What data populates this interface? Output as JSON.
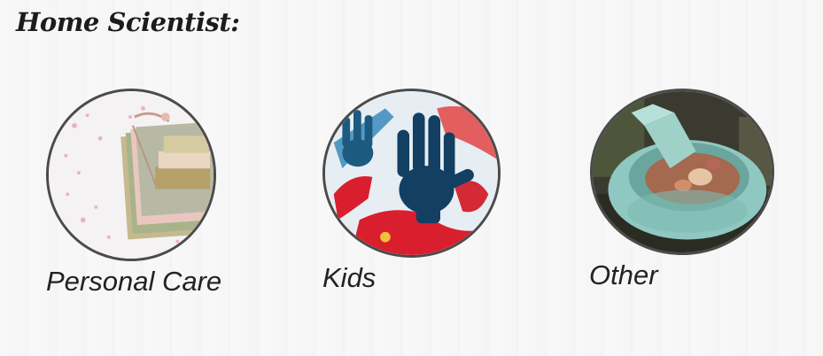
{
  "page": {
    "title": "Home Scientist:"
  },
  "categories": [
    {
      "label": "Personal Care",
      "image": "soap-bars-on-towels"
    },
    {
      "label": "Kids",
      "image": "painted-handprints"
    },
    {
      "label": "Other",
      "image": "mortar-and-pestle"
    }
  ]
}
